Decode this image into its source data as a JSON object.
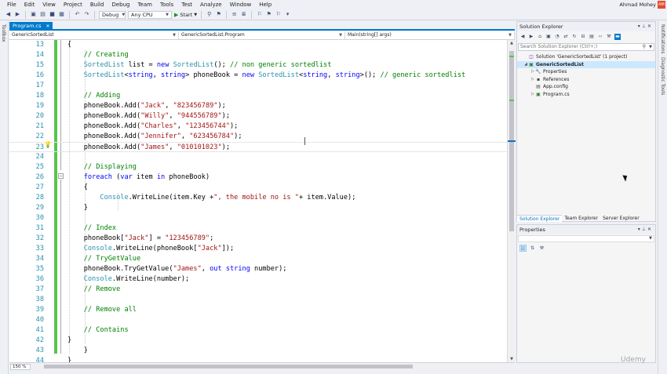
{
  "menu": {
    "items": [
      "File",
      "Edit",
      "View",
      "Project",
      "Build",
      "Debug",
      "Team",
      "Tools",
      "Test",
      "Analyze",
      "Window",
      "Help"
    ],
    "user_name": "Ahmad Mohey",
    "user_initials": "AM"
  },
  "toolbar": {
    "configuration": "Debug",
    "platform": "Any CPU",
    "start_label": "Start"
  },
  "left_strip": {
    "label": "Toolbox"
  },
  "editor": {
    "tab_label": "Program.cs",
    "nav_project": "GenericSortedList",
    "nav_class": "GenericSortedList.Program",
    "nav_member": "Main(string[] args)",
    "zoom": "150 %",
    "current_line": 23,
    "lines": [
      {
        "n": "13",
        "t": "        {"
      },
      {
        "n": "14",
        "t": "            // Creating"
      },
      {
        "n": "15",
        "t": "            SortedList list = new SortedList(); // non generic sortedlist"
      },
      {
        "n": "16",
        "t": "            SortedList<string, string> phoneBook = new SortedList<string, string>(); // generic sortedlist"
      },
      {
        "n": "17",
        "t": ""
      },
      {
        "n": "18",
        "t": "            // Adding"
      },
      {
        "n": "19",
        "t": "            phoneBook.Add(\"Jack\", \"823456789\");"
      },
      {
        "n": "20",
        "t": "            phoneBook.Add(\"Willy\", \"944556789\");"
      },
      {
        "n": "21",
        "t": "            phoneBook.Add(\"Charles\", \"123456744\");"
      },
      {
        "n": "22",
        "t": "            phoneBook.Add(\"Jennifer\", \"623456784\");"
      },
      {
        "n": "23",
        "t": "            phoneBook.Add(\"James\", \"010101023\");"
      },
      {
        "n": "24",
        "t": ""
      },
      {
        "n": "25",
        "t": "            // Displaying"
      },
      {
        "n": "26",
        "t": "            foreach (var item in phoneBook)"
      },
      {
        "n": "27",
        "t": "            {"
      },
      {
        "n": "28",
        "t": "                Console.WriteLine(item.Key +\", the mobile no is \"+ item.Value);"
      },
      {
        "n": "29",
        "t": "            }"
      },
      {
        "n": "30",
        "t": ""
      },
      {
        "n": "31",
        "t": "            // Index"
      },
      {
        "n": "32",
        "t": "            phoneBook[\"Jack\"] = \"123456789\";"
      },
      {
        "n": "33",
        "t": "            Console.WriteLine(phoneBook[\"Jack\"]);"
      },
      {
        "n": "34",
        "t": "            // TryGetValue"
      },
      {
        "n": "35",
        "t": "            phoneBook.TryGetValue(\"James\", out string number);"
      },
      {
        "n": "36",
        "t": "            Console.WriteLine(number);"
      },
      {
        "n": "37",
        "t": "            // Remove"
      },
      {
        "n": "38",
        "t": ""
      },
      {
        "n": "39",
        "t": "            // Remove all"
      },
      {
        "n": "40",
        "t": ""
      },
      {
        "n": "41",
        "t": "            // Contains"
      },
      {
        "n": "42",
        "t": "        }"
      },
      {
        "n": "43",
        "t": "    }"
      },
      {
        "n": "44",
        "t": "}"
      }
    ]
  },
  "solution_explorer": {
    "title": "Solution Explorer",
    "search_placeholder": "Search Solution Explorer (Ctrl+;)",
    "tree": [
      {
        "label": "Solution 'GenericSortedList' (1 project)",
        "level": 0,
        "icon": "solution-icon",
        "expander": ""
      },
      {
        "label": "GenericSortedList",
        "level": 0,
        "icon": "csharp-project-icon",
        "expander": "expanded",
        "selected": true
      },
      {
        "label": "Properties",
        "level": 1,
        "icon": "wrench-icon",
        "expander": "collapsed"
      },
      {
        "label": "References",
        "level": 1,
        "icon": "references-icon",
        "expander": "collapsed"
      },
      {
        "label": "App.config",
        "level": 1,
        "icon": "config-file-icon",
        "expander": ""
      },
      {
        "label": "Program.cs",
        "level": 1,
        "icon": "csharp-file-icon",
        "expander": "collapsed"
      }
    ],
    "tabs": [
      "Solution Explorer",
      "Team Explorer",
      "Server Explorer"
    ],
    "active_tab": 0
  },
  "properties": {
    "title": "Properties"
  },
  "right_strip": {
    "labels": [
      "Notifications",
      "Diagnostic Tools"
    ]
  },
  "watermark": "Udemy",
  "colors": {
    "accent": "#007acc",
    "keyword": "#0000ff",
    "type": "#2b91af",
    "string": "#a31515",
    "comment": "#008000",
    "change_bar": "#57c44f"
  }
}
